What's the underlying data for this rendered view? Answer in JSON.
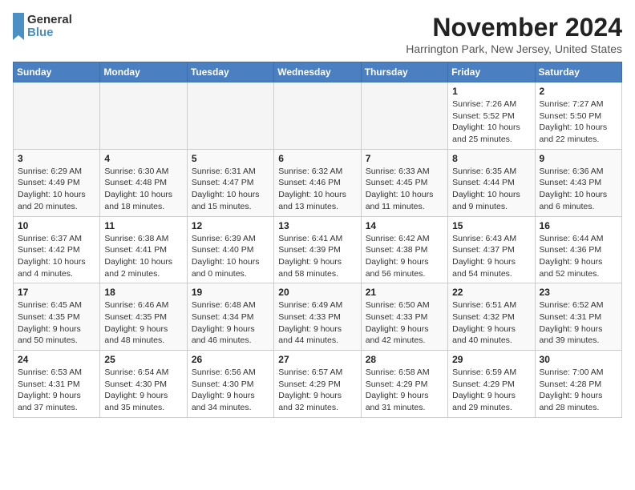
{
  "logo": {
    "text_general": "General",
    "text_blue": "Blue"
  },
  "title": "November 2024",
  "subtitle": "Harrington Park, New Jersey, United States",
  "days_of_week": [
    "Sunday",
    "Monday",
    "Tuesday",
    "Wednesday",
    "Thursday",
    "Friday",
    "Saturday"
  ],
  "weeks": [
    [
      {
        "day": "",
        "info": ""
      },
      {
        "day": "",
        "info": ""
      },
      {
        "day": "",
        "info": ""
      },
      {
        "day": "",
        "info": ""
      },
      {
        "day": "",
        "info": ""
      },
      {
        "day": "1",
        "info": "Sunrise: 7:26 AM\nSunset: 5:52 PM\nDaylight: 10 hours and 25 minutes."
      },
      {
        "day": "2",
        "info": "Sunrise: 7:27 AM\nSunset: 5:50 PM\nDaylight: 10 hours and 22 minutes."
      }
    ],
    [
      {
        "day": "3",
        "info": "Sunrise: 6:29 AM\nSunset: 4:49 PM\nDaylight: 10 hours and 20 minutes."
      },
      {
        "day": "4",
        "info": "Sunrise: 6:30 AM\nSunset: 4:48 PM\nDaylight: 10 hours and 18 minutes."
      },
      {
        "day": "5",
        "info": "Sunrise: 6:31 AM\nSunset: 4:47 PM\nDaylight: 10 hours and 15 minutes."
      },
      {
        "day": "6",
        "info": "Sunrise: 6:32 AM\nSunset: 4:46 PM\nDaylight: 10 hours and 13 minutes."
      },
      {
        "day": "7",
        "info": "Sunrise: 6:33 AM\nSunset: 4:45 PM\nDaylight: 10 hours and 11 minutes."
      },
      {
        "day": "8",
        "info": "Sunrise: 6:35 AM\nSunset: 4:44 PM\nDaylight: 10 hours and 9 minutes."
      },
      {
        "day": "9",
        "info": "Sunrise: 6:36 AM\nSunset: 4:43 PM\nDaylight: 10 hours and 6 minutes."
      }
    ],
    [
      {
        "day": "10",
        "info": "Sunrise: 6:37 AM\nSunset: 4:42 PM\nDaylight: 10 hours and 4 minutes."
      },
      {
        "day": "11",
        "info": "Sunrise: 6:38 AM\nSunset: 4:41 PM\nDaylight: 10 hours and 2 minutes."
      },
      {
        "day": "12",
        "info": "Sunrise: 6:39 AM\nSunset: 4:40 PM\nDaylight: 10 hours and 0 minutes."
      },
      {
        "day": "13",
        "info": "Sunrise: 6:41 AM\nSunset: 4:39 PM\nDaylight: 9 hours and 58 minutes."
      },
      {
        "day": "14",
        "info": "Sunrise: 6:42 AM\nSunset: 4:38 PM\nDaylight: 9 hours and 56 minutes."
      },
      {
        "day": "15",
        "info": "Sunrise: 6:43 AM\nSunset: 4:37 PM\nDaylight: 9 hours and 54 minutes."
      },
      {
        "day": "16",
        "info": "Sunrise: 6:44 AM\nSunset: 4:36 PM\nDaylight: 9 hours and 52 minutes."
      }
    ],
    [
      {
        "day": "17",
        "info": "Sunrise: 6:45 AM\nSunset: 4:35 PM\nDaylight: 9 hours and 50 minutes."
      },
      {
        "day": "18",
        "info": "Sunrise: 6:46 AM\nSunset: 4:35 PM\nDaylight: 9 hours and 48 minutes."
      },
      {
        "day": "19",
        "info": "Sunrise: 6:48 AM\nSunset: 4:34 PM\nDaylight: 9 hours and 46 minutes."
      },
      {
        "day": "20",
        "info": "Sunrise: 6:49 AM\nSunset: 4:33 PM\nDaylight: 9 hours and 44 minutes."
      },
      {
        "day": "21",
        "info": "Sunrise: 6:50 AM\nSunset: 4:33 PM\nDaylight: 9 hours and 42 minutes."
      },
      {
        "day": "22",
        "info": "Sunrise: 6:51 AM\nSunset: 4:32 PM\nDaylight: 9 hours and 40 minutes."
      },
      {
        "day": "23",
        "info": "Sunrise: 6:52 AM\nSunset: 4:31 PM\nDaylight: 9 hours and 39 minutes."
      }
    ],
    [
      {
        "day": "24",
        "info": "Sunrise: 6:53 AM\nSunset: 4:31 PM\nDaylight: 9 hours and 37 minutes."
      },
      {
        "day": "25",
        "info": "Sunrise: 6:54 AM\nSunset: 4:30 PM\nDaylight: 9 hours and 35 minutes."
      },
      {
        "day": "26",
        "info": "Sunrise: 6:56 AM\nSunset: 4:30 PM\nDaylight: 9 hours and 34 minutes."
      },
      {
        "day": "27",
        "info": "Sunrise: 6:57 AM\nSunset: 4:29 PM\nDaylight: 9 hours and 32 minutes."
      },
      {
        "day": "28",
        "info": "Sunrise: 6:58 AM\nSunset: 4:29 PM\nDaylight: 9 hours and 31 minutes."
      },
      {
        "day": "29",
        "info": "Sunrise: 6:59 AM\nSunset: 4:29 PM\nDaylight: 9 hours and 29 minutes."
      },
      {
        "day": "30",
        "info": "Sunrise: 7:00 AM\nSunset: 4:28 PM\nDaylight: 9 hours and 28 minutes."
      }
    ]
  ]
}
